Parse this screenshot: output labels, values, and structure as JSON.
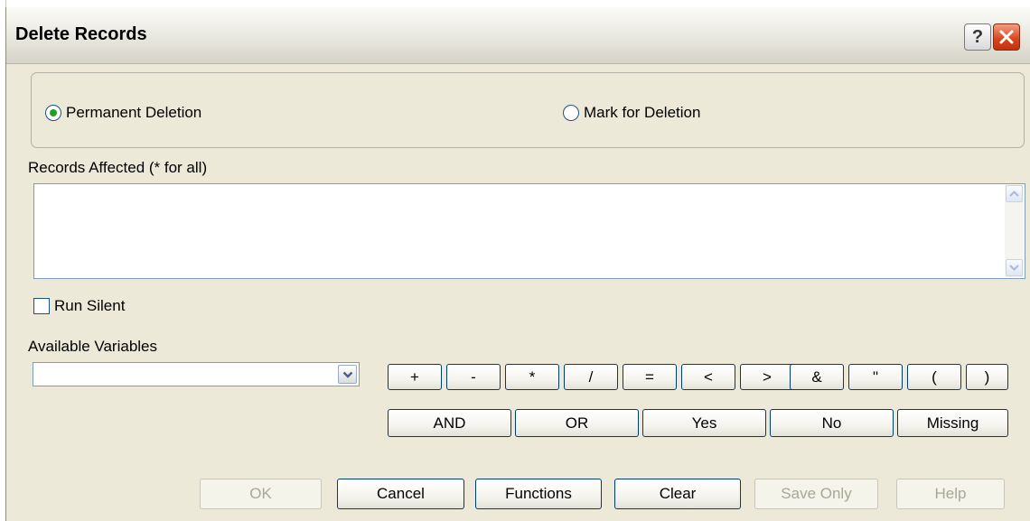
{
  "window": {
    "title": "Delete Records",
    "help_glyph": "?",
    "icons": {
      "help": "question-mark-icon",
      "close": "close-x-icon"
    }
  },
  "deletion_mode": {
    "options": [
      {
        "label": "Permanent Deletion",
        "selected": true
      },
      {
        "label": "Mark for Deletion",
        "selected": false
      }
    ]
  },
  "records": {
    "label": "Records Affected (* for all)",
    "value": ""
  },
  "run_silent": {
    "label": "Run Silent",
    "checked": false
  },
  "variables": {
    "label": "Available Variables",
    "selected": ""
  },
  "operators": [
    "+",
    "-",
    "*",
    "/",
    "=",
    "<",
    ">",
    "&",
    "\"",
    "(",
    ")"
  ],
  "keywords": [
    "AND",
    "OR",
    "Yes",
    "No",
    "Missing"
  ],
  "actions": {
    "ok": "OK",
    "cancel": "Cancel",
    "functions": "Functions",
    "clear": "Clear",
    "save_only": "Save Only",
    "help": "Help"
  },
  "colors": {
    "dialog_bg": "#ece9d8",
    "button_border": "#003c74",
    "radio_dot": "#21a121",
    "close_red": "#d9421c"
  }
}
